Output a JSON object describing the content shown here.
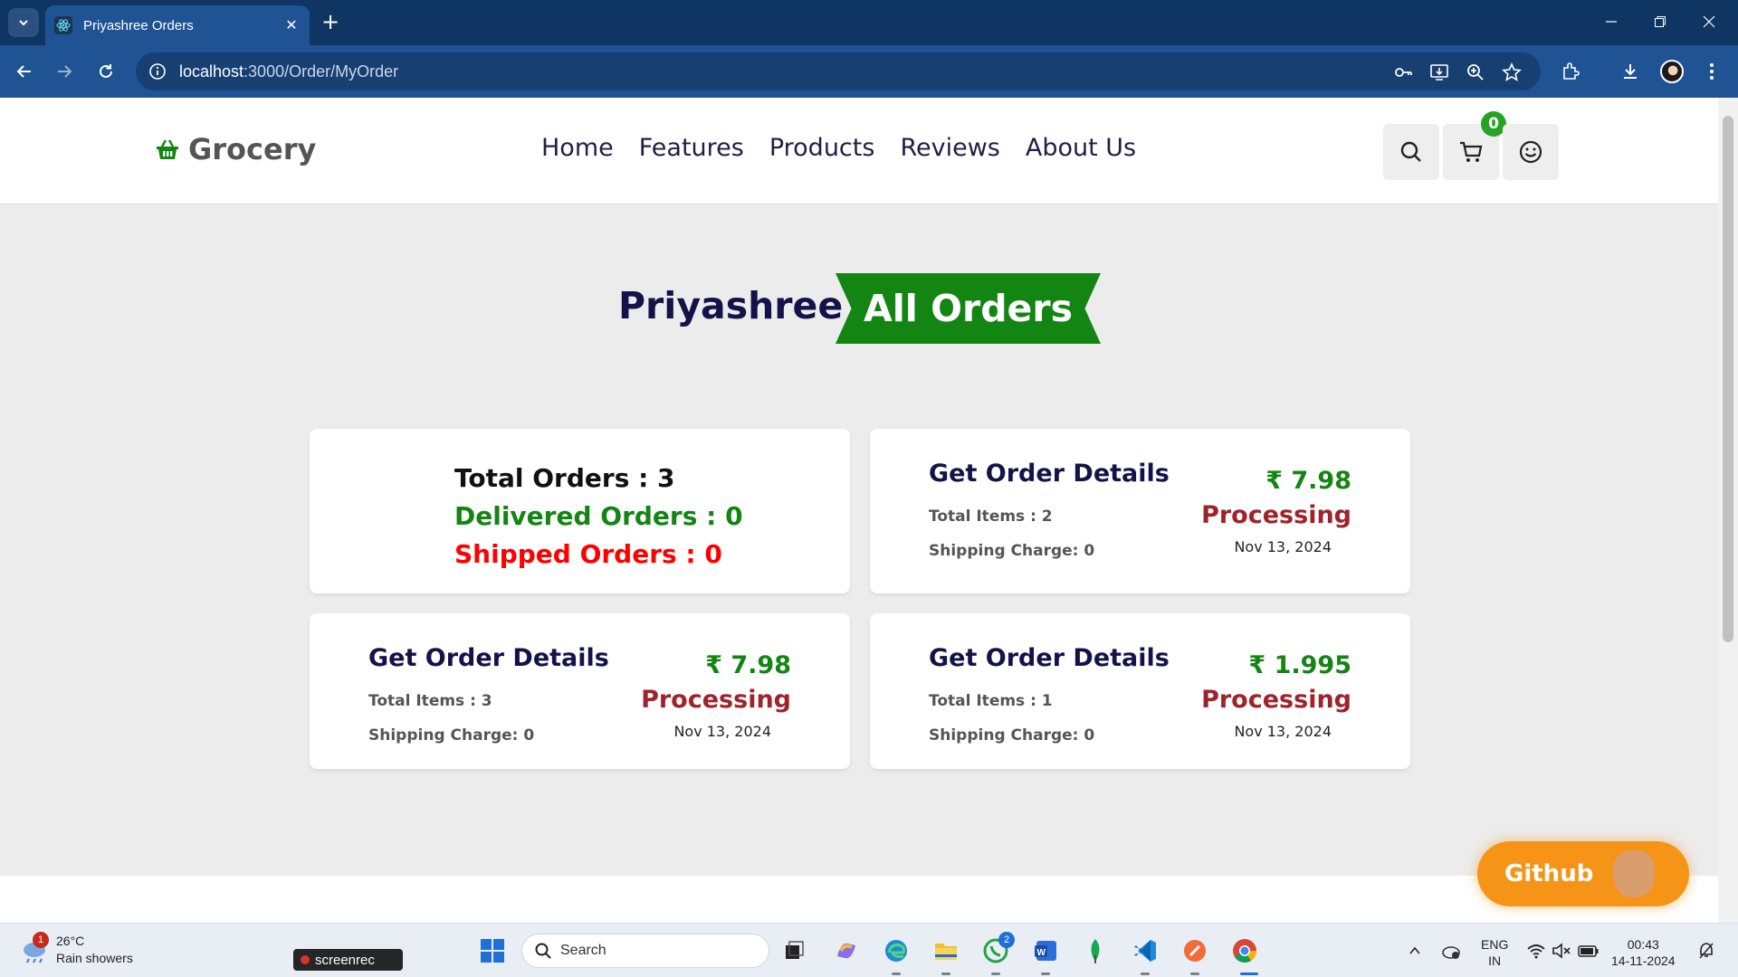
{
  "browser": {
    "tab_title": "Priyashree Orders",
    "url_host": "localhost",
    "url_path": ":3000/Order/MyOrder"
  },
  "header": {
    "logo": "Grocery",
    "nav": [
      "Home",
      "Features",
      "Products",
      "Reviews",
      "About Us"
    ],
    "cart_count": "0"
  },
  "heading": {
    "owner": "Priyashree",
    "banner": "All Orders"
  },
  "summary": {
    "total": "Total Orders : 3",
    "delivered": "Delivered Orders : 0",
    "shipped": "Shipped Orders : 0"
  },
  "orders": [
    {
      "title": "Get Order Details",
      "items": "Total Items : 2",
      "shipping": "Shipping Charge: 0",
      "price": "₹ 7.98",
      "status": "Processing",
      "date": "Nov 13, 2024"
    },
    {
      "title": "Get Order Details",
      "items": "Total Items : 3",
      "shipping": "Shipping Charge: 0",
      "price": "₹ 7.98",
      "status": "Processing",
      "date": "Nov 13, 2024"
    },
    {
      "title": "Get Order Details",
      "items": "Total Items : 1",
      "shipping": "Shipping Charge: 0",
      "price": "₹ 1.995",
      "status": "Processing",
      "date": "Nov 13, 2024"
    }
  ],
  "github_label": "Github",
  "taskbar": {
    "weather_temp": "26°C",
    "weather_desc": "Rain showers",
    "weather_badge": "1",
    "screenrec": "screenrec",
    "search_placeholder": "Search",
    "whatsapp_badge": "2",
    "lang_1": "ENG",
    "lang_2": "IN",
    "time": "00:43",
    "date": "14-11-2024"
  },
  "colors": {
    "brand_green": "#138513",
    "navy": "#13134a",
    "processing_red": "#a0232b",
    "shipped_red": "#ff0000",
    "github_orange": "#f59416"
  }
}
